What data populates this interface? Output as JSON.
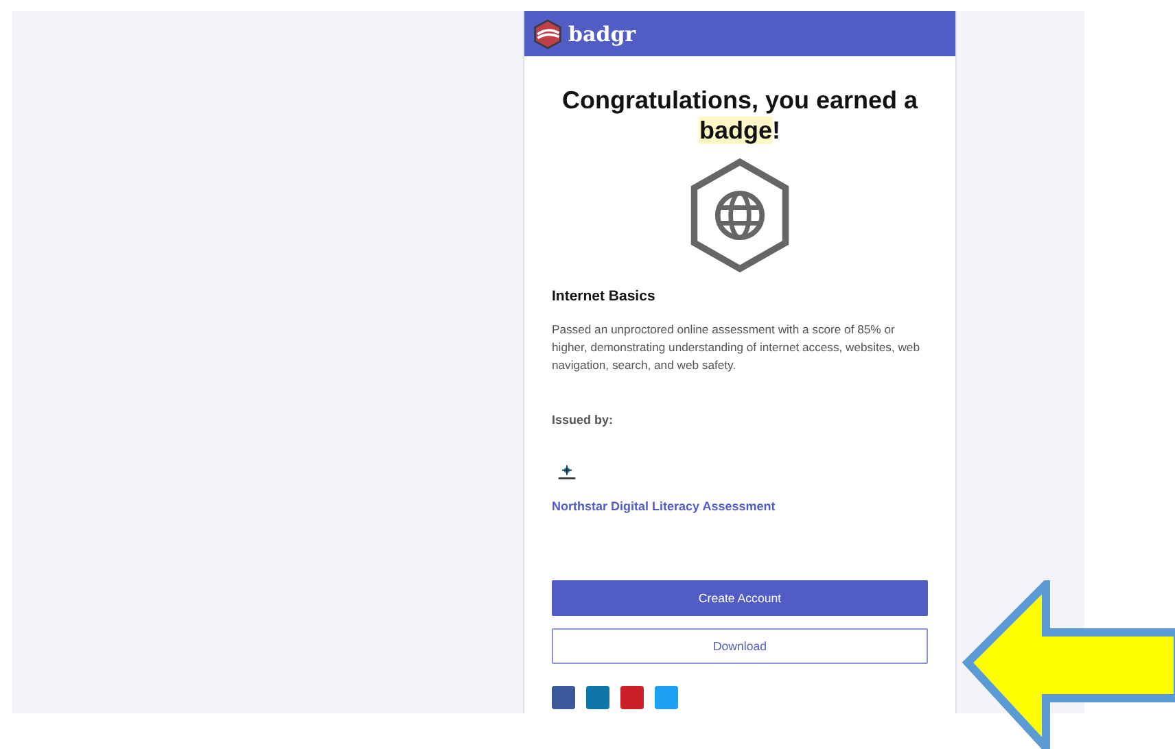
{
  "header": {
    "brand": "badgr"
  },
  "title": {
    "before": "Congratulations, you earned a ",
    "highlight": "badge",
    "after": "!"
  },
  "badge": {
    "name": "Internet Basics",
    "description": "Passed an unproctored online assessment with a score of 85% or higher, demonstrating understanding of internet access, websites, web navigation, search, and web safety."
  },
  "issuer": {
    "label": "Issued by:",
    "name": "Northstar Digital Literacy Assessment"
  },
  "buttons": [
    {
      "label": "Create Account",
      "kind": "primary"
    },
    {
      "label": "Download",
      "kind": "outline"
    }
  ],
  "share_icons": [
    {
      "color": "#3b5998"
    },
    {
      "color": "#0e76a8"
    },
    {
      "color": "#cb2027"
    },
    {
      "color": "#1da1f2"
    }
  ]
}
